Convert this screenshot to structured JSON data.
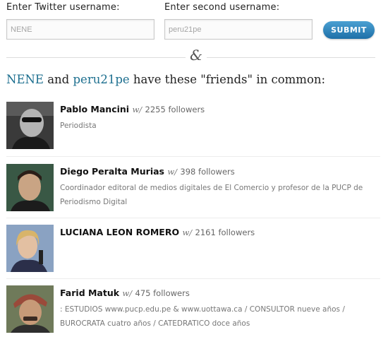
{
  "form": {
    "label1": "Enter Twitter username:",
    "label2": "Enter second username:",
    "value1": "NENE",
    "value2": "peru21pe",
    "submit": "SUBMIT"
  },
  "divider_symbol": "&",
  "headline": {
    "user1": "NENE",
    "and": " and ",
    "user2": "peru21pe",
    "rest": " have these \"friends\" in common:"
  },
  "friends": [
    {
      "name": "Pablo Mancini",
      "w": "w/",
      "followers": "2255 followers",
      "bio": "Periodista"
    },
    {
      "name": "Diego Peralta Murias",
      "w": "w/",
      "followers": "398 followers",
      "bio": "Coordinador editoral de medios digitales de El Comercio y profesor de la PUCP de Periodismo Digital"
    },
    {
      "name": "LUCIANA LEON ROMERO",
      "w": "w/",
      "followers": "2161 followers",
      "bio": ""
    },
    {
      "name": "Farid Matuk",
      "w": "w/",
      "followers": "475 followers",
      "bio": ": ESTUDIOS www.pucp.edu.pe & www.uottawa.ca / CONSULTOR nueve años / BUROCRATA cuatro años / CATEDRATICO doce años"
    }
  ]
}
